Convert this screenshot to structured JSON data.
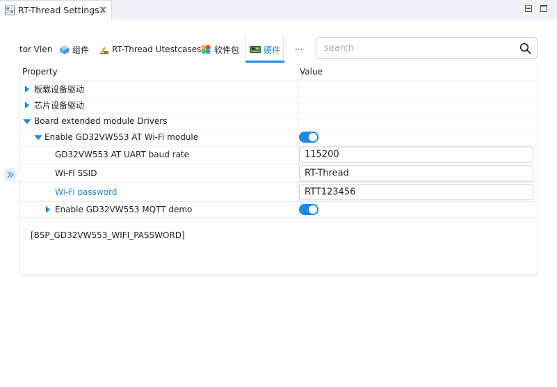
{
  "editor": {
    "tab_title": "RT-Thread Settings"
  },
  "categories": [
    {
      "label": "tor Vlen",
      "icon": "none"
    },
    {
      "label": "组件",
      "icon": "cube-icon"
    },
    {
      "label": "RT-Thread Utestcases",
      "icon": "test-tools-icon"
    },
    {
      "label": "软件包",
      "icon": "packages-icon"
    },
    {
      "label": "硬件",
      "icon": "hardware-board-icon",
      "active": true
    },
    {
      "label": "···",
      "icon": "more-icon"
    }
  ],
  "search": {
    "placeholder": "search"
  },
  "table": {
    "header_property": "Property",
    "header_value": "Value",
    "rows": [
      {
        "label": "板载设备驱动",
        "expander": "collapsed"
      },
      {
        "label": "芯片设备驱动",
        "expander": "collapsed"
      },
      {
        "label": "Board extended module Drivers",
        "expander": "expanded"
      },
      {
        "label": "Enable GD32VW553 AT Wi-Fi module",
        "expander": "expanded",
        "toggle": true
      },
      {
        "label": "GD32VW553 AT UART baud rate",
        "value": "115200"
      },
      {
        "label": "Wi-Fi SSID",
        "value": "RT-Thread"
      },
      {
        "label": "Wi-Fi password",
        "value": "RTT123456",
        "selected": true
      },
      {
        "label": "Enable GD32VW553 MQTT demo",
        "expander": "collapsed",
        "toggle": true
      }
    ]
  },
  "description": "[BSP_GD32VW553_WIFI_PASSWORD]",
  "colors": {
    "accent": "#1e88e5",
    "selected_label": "#2a8bd6"
  }
}
